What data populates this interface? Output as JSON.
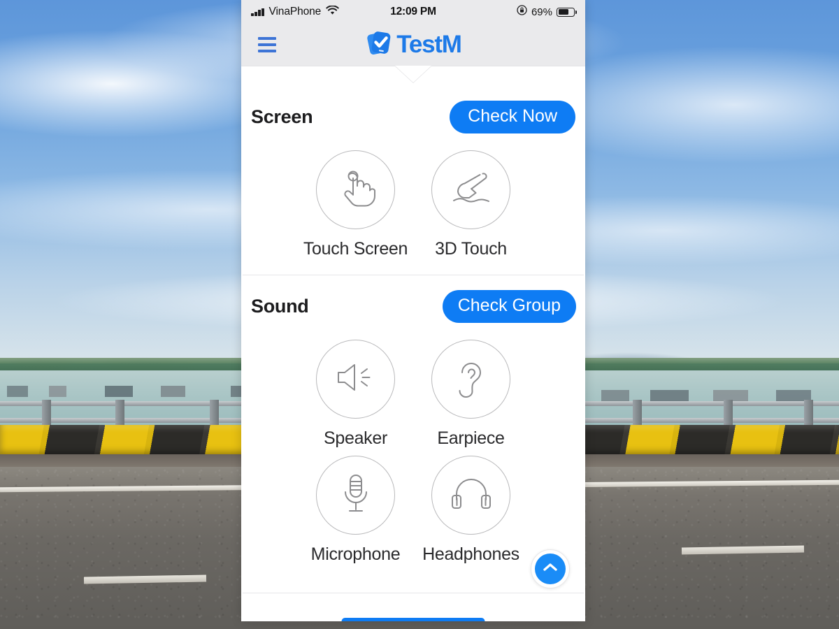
{
  "background": {
    "description": "photo of a coastal bridge road with water, fishing rafts, mountains and sky",
    "accent_sky": "#5d96da",
    "accent_water": "#a9c5c5",
    "accent_barrier_yellow": "#e8c111",
    "accent_road": "#6b6863"
  },
  "status_bar": {
    "carrier": "VinaPhone",
    "wifi_icon": "wifi-icon",
    "signal_icon": "cellular-signal-icon",
    "time": "12:09 PM",
    "lock_icon": "rotation-lock-icon",
    "battery_percent": "69%",
    "battery_level": 69,
    "background": "#eaeaec"
  },
  "app_bar": {
    "menu_icon": "hamburger-menu-icon",
    "logo_icon": "testm-logo-icon",
    "brand_name": "TestM",
    "brand_color": "#1d7ae8",
    "background": "#eaeaec"
  },
  "sections": [
    {
      "title": "Screen",
      "action_label": "Check Now",
      "action_color": "#0e7cf4",
      "tiles": [
        {
          "label": "Touch Screen",
          "icon": "touch-hand-icon"
        },
        {
          "label": "3D Touch",
          "icon": "pressing-finger-icon"
        }
      ]
    },
    {
      "title": "Sound",
      "action_label": "Check Group",
      "action_color": "#0e7cf4",
      "tiles": [
        {
          "label": "Speaker",
          "icon": "speaker-icon"
        },
        {
          "label": "Earpiece",
          "icon": "ear-icon"
        },
        {
          "label": "Microphone",
          "icon": "microphone-icon"
        },
        {
          "label": "Headphones",
          "icon": "headphones-icon"
        }
      ]
    }
  ],
  "scroll_top_button": {
    "icon": "chevron-up-icon",
    "color": "#1a8cf7"
  }
}
